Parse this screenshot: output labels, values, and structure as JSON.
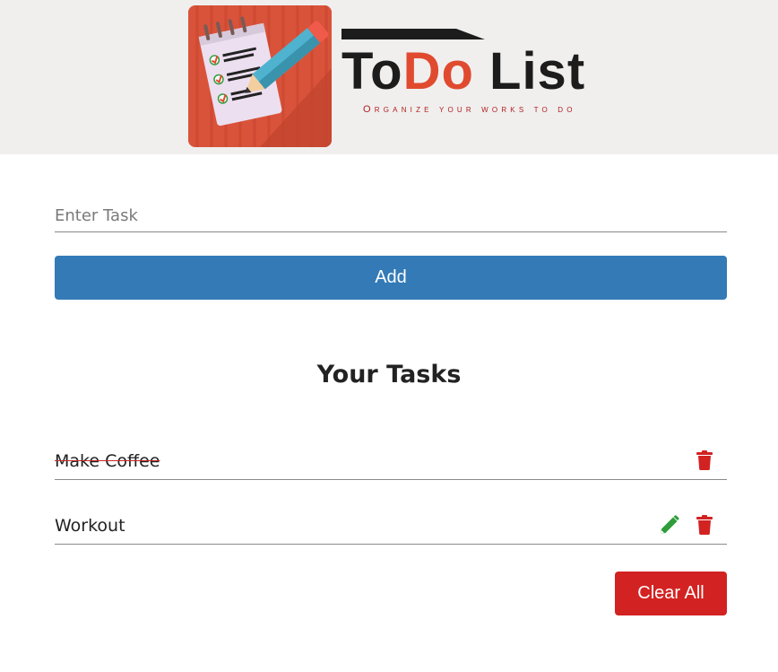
{
  "header": {
    "logo_word_1": "To",
    "logo_word_2": "Do",
    "logo_word_3": "List",
    "tagline": "Organize your works to do",
    "logo_icon": "notepad-pencil-icon"
  },
  "form": {
    "placeholder": "Enter Task",
    "value": "",
    "add_label": "Add"
  },
  "list": {
    "title": "Your Tasks",
    "tasks": [
      {
        "text": "Make Coffee",
        "done": true
      },
      {
        "text": "Workout",
        "done": false
      }
    ],
    "clear_label": "Clear All"
  },
  "colors": {
    "primary": "#337ab7",
    "danger": "#d32222",
    "edit": "#2e9d3a",
    "header_bg": "#f0efee",
    "logo_red": "#d9533a"
  }
}
